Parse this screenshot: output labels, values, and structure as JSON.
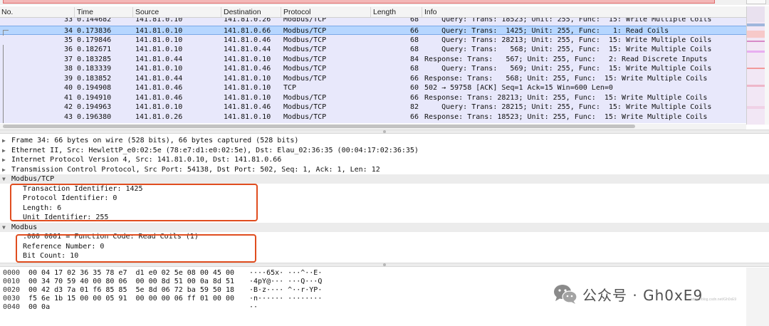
{
  "columns": {
    "no": "No.",
    "time": "Time",
    "source": "Source",
    "destination": "Destination",
    "protocol": "Protocol",
    "length": "Length",
    "info": "Info"
  },
  "packets": [
    {
      "no": "33",
      "time": "0.144682",
      "src": "141.81.0.10",
      "dst": "141.81.0.26",
      "proto": "Modbus/TCP",
      "len": "68",
      "info": "    Query: Trans: 18523; Unit: 255, Func:  15: Write Multiple Coils"
    },
    {
      "no": "34",
      "time": "0.173836",
      "src": "141.81.0.10",
      "dst": "141.81.0.66",
      "proto": "Modbus/TCP",
      "len": "66",
      "info": "    Query: Trans:  1425; Unit: 255, Func:   1: Read Coils"
    },
    {
      "no": "35",
      "time": "0.179846",
      "src": "141.81.0.10",
      "dst": "141.81.0.46",
      "proto": "Modbus/TCP",
      "len": "68",
      "info": "    Query: Trans: 28213; Unit: 255, Func:  15: Write Multiple Coils"
    },
    {
      "no": "36",
      "time": "0.182671",
      "src": "141.81.0.10",
      "dst": "141.81.0.44",
      "proto": "Modbus/TCP",
      "len": "68",
      "info": "    Query: Trans:   568; Unit: 255, Func:  15: Write Multiple Coils"
    },
    {
      "no": "37",
      "time": "0.183285",
      "src": "141.81.0.44",
      "dst": "141.81.0.10",
      "proto": "Modbus/TCP",
      "len": "84",
      "info": "Response: Trans:   567; Unit: 255, Func:   2: Read Discrete Inputs"
    },
    {
      "no": "38",
      "time": "0.183339",
      "src": "141.81.0.10",
      "dst": "141.81.0.46",
      "proto": "Modbus/TCP",
      "len": "68",
      "info": "    Query: Trans:   569; Unit: 255, Func:  15: Write Multiple Coils"
    },
    {
      "no": "39",
      "time": "0.183852",
      "src": "141.81.0.44",
      "dst": "141.81.0.10",
      "proto": "Modbus/TCP",
      "len": "66",
      "info": "Response: Trans:   568; Unit: 255, Func:  15: Write Multiple Coils"
    },
    {
      "no": "40",
      "time": "0.194908",
      "src": "141.81.0.46",
      "dst": "141.81.0.10",
      "proto": "TCP",
      "len": "60",
      "info": "502 → 59758 [ACK] Seq=1 Ack=15 Win=600 Len=0"
    },
    {
      "no": "41",
      "time": "0.194910",
      "src": "141.81.0.46",
      "dst": "141.81.0.10",
      "proto": "Modbus/TCP",
      "len": "66",
      "info": "Response: Trans: 28213; Unit: 255, Func:  15: Write Multiple Coils"
    },
    {
      "no": "42",
      "time": "0.194963",
      "src": "141.81.0.10",
      "dst": "141.81.0.46",
      "proto": "Modbus/TCP",
      "len": "82",
      "info": "    Query: Trans: 28215; Unit: 255, Func:  15: Write Multiple Coils"
    },
    {
      "no": "43",
      "time": "0.196380",
      "src": "141.81.0.26",
      "dst": "141.81.0.10",
      "proto": "Modbus/TCP",
      "len": "66",
      "info": "Response: Trans: 18523; Unit: 255, Func:  15: Write Multiple Coils"
    }
  ],
  "details": {
    "frame": "Frame 34: 66 bytes on wire (528 bits), 66 bytes captured (528 bits)",
    "ethernet": "Ethernet II, Src: HewlettP_e0:02:5e (78:e7:d1:e0:02:5e), Dst: Elau_02:36:35 (00:04:17:02:36:35)",
    "ip": "Internet Protocol Version 4, Src: 141.81.0.10, Dst: 141.81.0.66",
    "tcp": "Transmission Control Protocol, Src Port: 54138, Dst Port: 502, Seq: 1, Ack: 1, Len: 12",
    "mbtcp": {
      "title": "Modbus/TCP",
      "fields": [
        "Transaction Identifier: 1425",
        "Protocol Identifier: 0",
        "Length: 6",
        "Unit Identifier: 255"
      ]
    },
    "modbus": {
      "title": "Modbus",
      "fields": [
        ".000 0001 = Function Code: Read Coils (1)",
        "Reference Number: 0",
        "Bit Count: 10"
      ]
    }
  },
  "bytes": [
    {
      "offset": "0000",
      "hex": "00 04 17 02 36 35 78 e7  d1 e0 02 5e 08 00 45 00",
      "ascii": "····65x· ···^··E·"
    },
    {
      "offset": "0010",
      "hex": "00 34 70 59 40 00 80 06  00 00 8d 51 00 0a 8d 51",
      "ascii": "·4pY@··· ···Q···Q"
    },
    {
      "offset": "0020",
      "hex": "00 42 d3 7a 01 f6 85 85  5e 8d 06 72 ba 59 50 18",
      "ascii": "·B·z···· ^··r·YP·"
    },
    {
      "offset": "0030",
      "hex": "f5 6e 1b 15 00 00 05 91  00 00 00 06 ff 01 00 00",
      "ascii": "·n······ ········"
    },
    {
      "offset": "0040",
      "hex": "00 0a",
      "ascii": "··"
    }
  ],
  "watermark": {
    "text": "公众号 · Gh0xE9",
    "icon": "wechat-icon",
    "url": "https://blog.csdn.net/Gh0xE9"
  },
  "colors": {
    "row_bg": "#e8e8fb",
    "selected_bg": "#b6d6ff",
    "highlight_box": "#e04d1f"
  }
}
